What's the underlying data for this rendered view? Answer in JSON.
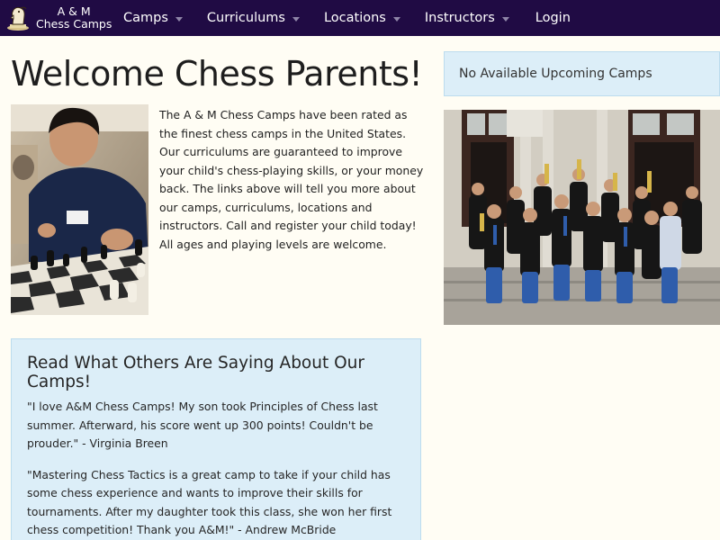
{
  "brand": {
    "line1": "A & M",
    "line2": "Chess Camps",
    "logo": "chess-knight-icon"
  },
  "nav": {
    "items": [
      {
        "label": "Camps",
        "has_dropdown": true
      },
      {
        "label": "Curriculums",
        "has_dropdown": true
      },
      {
        "label": "Locations",
        "has_dropdown": true
      },
      {
        "label": "Instructors",
        "has_dropdown": true
      },
      {
        "label": "Login",
        "has_dropdown": false
      }
    ]
  },
  "main": {
    "title": "Welcome Chess Parents!",
    "intro": "The A & M Chess Camps have been rated as the finest chess camps in the United States. Our curriculums are guaranteed to improve your child's chess-playing skills, or your money back. The links above will tell you more about our camps, curriculums, locations and instructors. Call and register your child today! All ages and playing levels are welcome."
  },
  "sidebar": {
    "upcoming": "No Available Upcoming Camps"
  },
  "testimonials": {
    "heading": "Read What Others Are Saying About Our Camps!",
    "quotes": [
      "\"I love A&M Chess Camps! My son took Principles of Chess last summer. Afterward, his score went up 300 points! Couldn't be prouder.\" - Virginia Breen",
      "\"Mastering Chess Tactics is a great camp to take if your child has some chess experience and wants to improve their skills for tournaments. After my daughter took this class, she won her first chess competition! Thank you A&M!\" - Andrew McBride"
    ]
  },
  "colors": {
    "navbar": "#200b44",
    "page_bg": "#fffdf4",
    "panel_bg": "#dceef8"
  }
}
